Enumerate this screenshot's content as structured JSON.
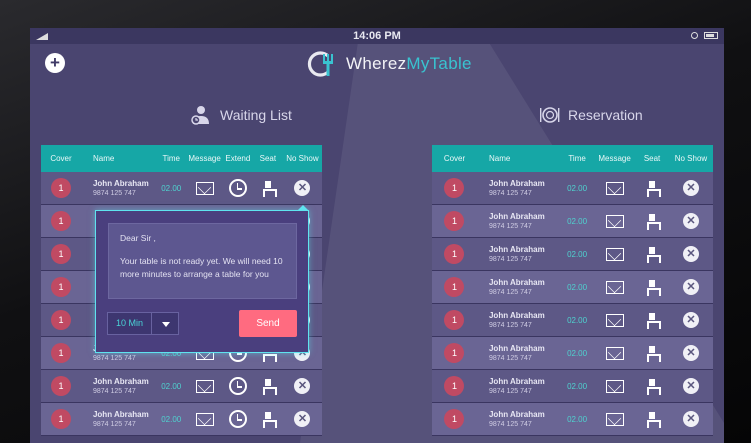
{
  "status": {
    "time": "14:06 PM"
  },
  "header": {
    "logo_part1": "Wherez",
    "logo_part2": "MyTable"
  },
  "sections": {
    "waiting_title": "Waiting List",
    "reservation_title": "Reservation"
  },
  "waiting_table": {
    "columns": [
      "Cover",
      "Name",
      "Time",
      "Message",
      "Extend",
      "Seat",
      "No Show"
    ],
    "rows": [
      {
        "cover": "1",
        "name": "John Abraham",
        "phone": "9874 125 747",
        "time": "02.00"
      },
      {
        "cover": "1",
        "name": "",
        "phone": "",
        "time": ""
      },
      {
        "cover": "1",
        "name": "",
        "phone": "",
        "time": ""
      },
      {
        "cover": "1",
        "name": "",
        "phone": "",
        "time": ""
      },
      {
        "cover": "1",
        "name": "",
        "phone": "",
        "time": ""
      },
      {
        "cover": "1",
        "name": "John Abraham",
        "phone": "9874 125 747",
        "time": "02.00"
      },
      {
        "cover": "1",
        "name": "John Abraham",
        "phone": "9874 125 747",
        "time": "02.00"
      },
      {
        "cover": "1",
        "name": "John Abraham",
        "phone": "9874 125 747",
        "time": "02.00"
      }
    ]
  },
  "reservation_table": {
    "columns": [
      "Cover",
      "Name",
      "Time",
      "Message",
      "Seat",
      "No Show"
    ],
    "rows": [
      {
        "cover": "1",
        "name": "John Abraham",
        "phone": "9874 125 747",
        "time": "02.00"
      },
      {
        "cover": "1",
        "name": "John Abraham",
        "phone": "9874 125 747",
        "time": "02.00"
      },
      {
        "cover": "1",
        "name": "John Abraham",
        "phone": "9874 125 747",
        "time": "02.00"
      },
      {
        "cover": "1",
        "name": "John Abraham",
        "phone": "9874 125 747",
        "time": "02.00"
      },
      {
        "cover": "1",
        "name": "John Abraham",
        "phone": "9874 125 747",
        "time": "02.00"
      },
      {
        "cover": "1",
        "name": "John Abraham",
        "phone": "9874 125 747",
        "time": "02.00"
      },
      {
        "cover": "1",
        "name": "John Abraham",
        "phone": "9874 125 747",
        "time": "02.00"
      },
      {
        "cover": "1",
        "name": "John Abraham",
        "phone": "9874 125 747",
        "time": "02.00"
      }
    ]
  },
  "popup": {
    "greeting": "Dear Sir ,",
    "message": "Your table is not ready yet. We will need 10 more minutes to arrange a table for you",
    "time_option": "10 Min",
    "send_label": "Send"
  },
  "colors": {
    "accent_teal": "#16a7a6",
    "send_pink": "#ff6b80",
    "cover_red": "#c04a63"
  }
}
